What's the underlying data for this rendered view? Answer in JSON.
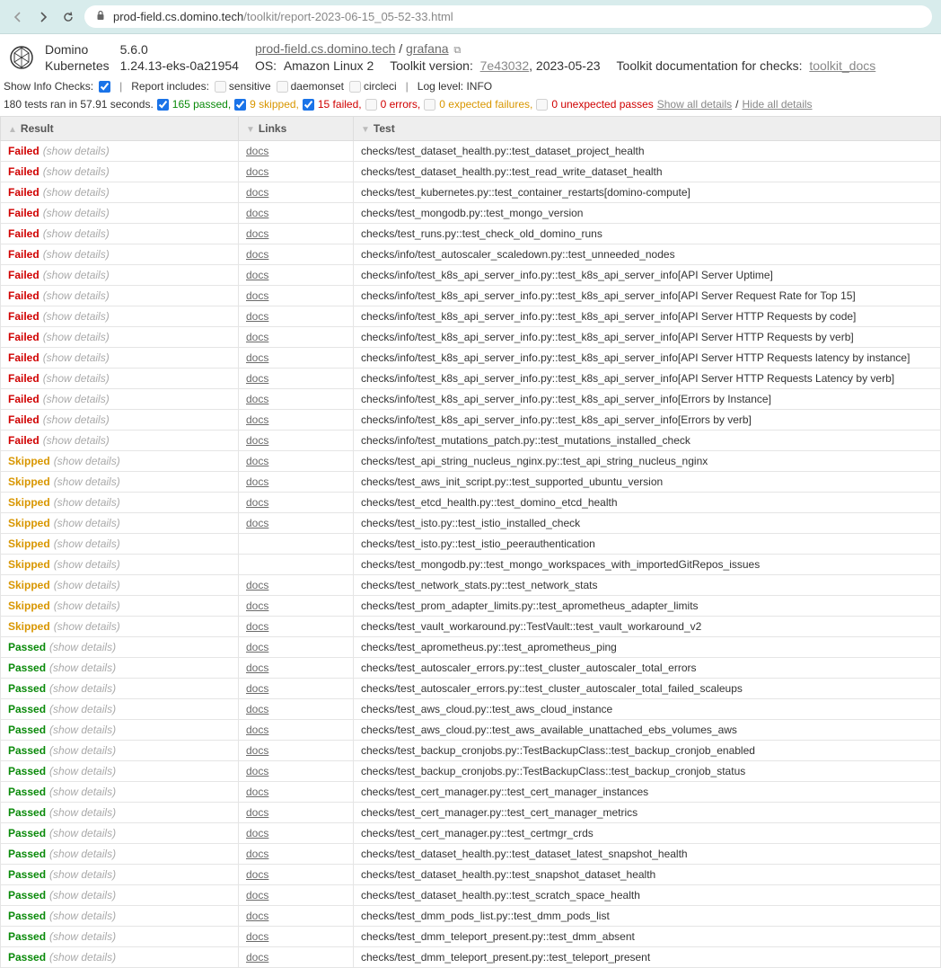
{
  "browser": {
    "url_host": "prod-field.cs.domino.tech",
    "url_path": "/toolkit/report-2023-06-15_05-52-33.html"
  },
  "header": {
    "product": "Domino",
    "version": "5.6.0",
    "platform": "Kubernetes",
    "k8s_version": "1.24.13-eks-0a21954",
    "host_link": "prod-field.cs.domino.tech",
    "grafana": "grafana",
    "os_label": "OS:",
    "os_value": "Amazon Linux 2",
    "tk_version_label": "Toolkit version:",
    "tk_version_value": "7e43032",
    "tk_date": ", 2023-05-23",
    "tk_docs_label": "Toolkit documentation for checks:",
    "tk_docs_link": "toolkit_docs"
  },
  "filters": {
    "show_info_label": "Show Info Checks:",
    "report_includes": "Report includes:",
    "sensitive": "sensitive",
    "daemonset": "daemonset",
    "circleci": "circleci",
    "log_level": "Log level: INFO"
  },
  "summary": {
    "text": "180 tests ran in 57.91 seconds.",
    "passed": "165 passed,",
    "skipped": "9 skipped,",
    "failed": "15 failed,",
    "errors": "0 errors,",
    "xfail": "0 expected failures,",
    "xpass": "0 unexpected passes",
    "show_all": "Show all details",
    "hide_all": "Hide all details"
  },
  "table": {
    "h_result": "Result",
    "h_links": "Links",
    "h_test": "Test",
    "show_details": "(show details)",
    "docs": "docs"
  },
  "rows": [
    {
      "r": "Failed",
      "l": true,
      "t": "checks/test_dataset_health.py::test_dataset_project_health"
    },
    {
      "r": "Failed",
      "l": true,
      "t": "checks/test_dataset_health.py::test_read_write_dataset_health"
    },
    {
      "r": "Failed",
      "l": true,
      "t": "checks/test_kubernetes.py::test_container_restarts[domino-compute]"
    },
    {
      "r": "Failed",
      "l": true,
      "t": "checks/test_mongodb.py::test_mongo_version"
    },
    {
      "r": "Failed",
      "l": true,
      "t": "checks/test_runs.py::test_check_old_domino_runs"
    },
    {
      "r": "Failed",
      "l": true,
      "t": "checks/info/test_autoscaler_scaledown.py::test_unneeded_nodes"
    },
    {
      "r": "Failed",
      "l": true,
      "t": "checks/info/test_k8s_api_server_info.py::test_k8s_api_server_info[API Server Uptime]"
    },
    {
      "r": "Failed",
      "l": true,
      "t": "checks/info/test_k8s_api_server_info.py::test_k8s_api_server_info[API Server Request Rate for Top 15]"
    },
    {
      "r": "Failed",
      "l": true,
      "t": "checks/info/test_k8s_api_server_info.py::test_k8s_api_server_info[API Server HTTP Requests by code]"
    },
    {
      "r": "Failed",
      "l": true,
      "t": "checks/info/test_k8s_api_server_info.py::test_k8s_api_server_info[API Server HTTP Requests by verb]"
    },
    {
      "r": "Failed",
      "l": true,
      "t": "checks/info/test_k8s_api_server_info.py::test_k8s_api_server_info[API Server HTTP Requests latency by instance]"
    },
    {
      "r": "Failed",
      "l": true,
      "t": "checks/info/test_k8s_api_server_info.py::test_k8s_api_server_info[API Server HTTP Requests Latency by verb]"
    },
    {
      "r": "Failed",
      "l": true,
      "t": "checks/info/test_k8s_api_server_info.py::test_k8s_api_server_info[Errors by Instance]"
    },
    {
      "r": "Failed",
      "l": true,
      "t": "checks/info/test_k8s_api_server_info.py::test_k8s_api_server_info[Errors by verb]"
    },
    {
      "r": "Failed",
      "l": true,
      "t": "checks/info/test_mutations_patch.py::test_mutations_installed_check"
    },
    {
      "r": "Skipped",
      "l": true,
      "t": "checks/test_api_string_nucleus_nginx.py::test_api_string_nucleus_nginx"
    },
    {
      "r": "Skipped",
      "l": true,
      "t": "checks/test_aws_init_script.py::test_supported_ubuntu_version"
    },
    {
      "r": "Skipped",
      "l": true,
      "t": "checks/test_etcd_health.py::test_domino_etcd_health"
    },
    {
      "r": "Skipped",
      "l": true,
      "t": "checks/test_isto.py::test_istio_installed_check"
    },
    {
      "r": "Skipped",
      "l": false,
      "t": "checks/test_isto.py::test_istio_peerauthentication"
    },
    {
      "r": "Skipped",
      "l": false,
      "t": "checks/test_mongodb.py::test_mongo_workspaces_with_importedGitRepos_issues"
    },
    {
      "r": "Skipped",
      "l": true,
      "t": "checks/test_network_stats.py::test_network_stats"
    },
    {
      "r": "Skipped",
      "l": true,
      "t": "checks/test_prom_adapter_limits.py::test_aprometheus_adapter_limits"
    },
    {
      "r": "Skipped",
      "l": true,
      "t": "checks/test_vault_workaround.py::TestVault::test_vault_workaround_v2"
    },
    {
      "r": "Passed",
      "l": true,
      "t": "checks/test_aprometheus.py::test_aprometheus_ping"
    },
    {
      "r": "Passed",
      "l": true,
      "t": "checks/test_autoscaler_errors.py::test_cluster_autoscaler_total_errors"
    },
    {
      "r": "Passed",
      "l": true,
      "t": "checks/test_autoscaler_errors.py::test_cluster_autoscaler_total_failed_scaleups"
    },
    {
      "r": "Passed",
      "l": true,
      "t": "checks/test_aws_cloud.py::test_aws_cloud_instance"
    },
    {
      "r": "Passed",
      "l": true,
      "t": "checks/test_aws_cloud.py::test_aws_available_unattached_ebs_volumes_aws"
    },
    {
      "r": "Passed",
      "l": true,
      "t": "checks/test_backup_cronjobs.py::TestBackupClass::test_backup_cronjob_enabled"
    },
    {
      "r": "Passed",
      "l": true,
      "t": "checks/test_backup_cronjobs.py::TestBackupClass::test_backup_cronjob_status"
    },
    {
      "r": "Passed",
      "l": true,
      "t": "checks/test_cert_manager.py::test_cert_manager_instances"
    },
    {
      "r": "Passed",
      "l": true,
      "t": "checks/test_cert_manager.py::test_cert_manager_metrics"
    },
    {
      "r": "Passed",
      "l": true,
      "t": "checks/test_cert_manager.py::test_certmgr_crds"
    },
    {
      "r": "Passed",
      "l": true,
      "t": "checks/test_dataset_health.py::test_dataset_latest_snapshot_health"
    },
    {
      "r": "Passed",
      "l": true,
      "t": "checks/test_dataset_health.py::test_snapshot_dataset_health"
    },
    {
      "r": "Passed",
      "l": true,
      "t": "checks/test_dataset_health.py::test_scratch_space_health"
    },
    {
      "r": "Passed",
      "l": true,
      "t": "checks/test_dmm_pods_list.py::test_dmm_pods_list"
    },
    {
      "r": "Passed",
      "l": true,
      "t": "checks/test_dmm_teleport_present.py::test_dmm_absent"
    },
    {
      "r": "Passed",
      "l": true,
      "t": "checks/test_dmm_teleport_present.py::test_teleport_present"
    }
  ]
}
